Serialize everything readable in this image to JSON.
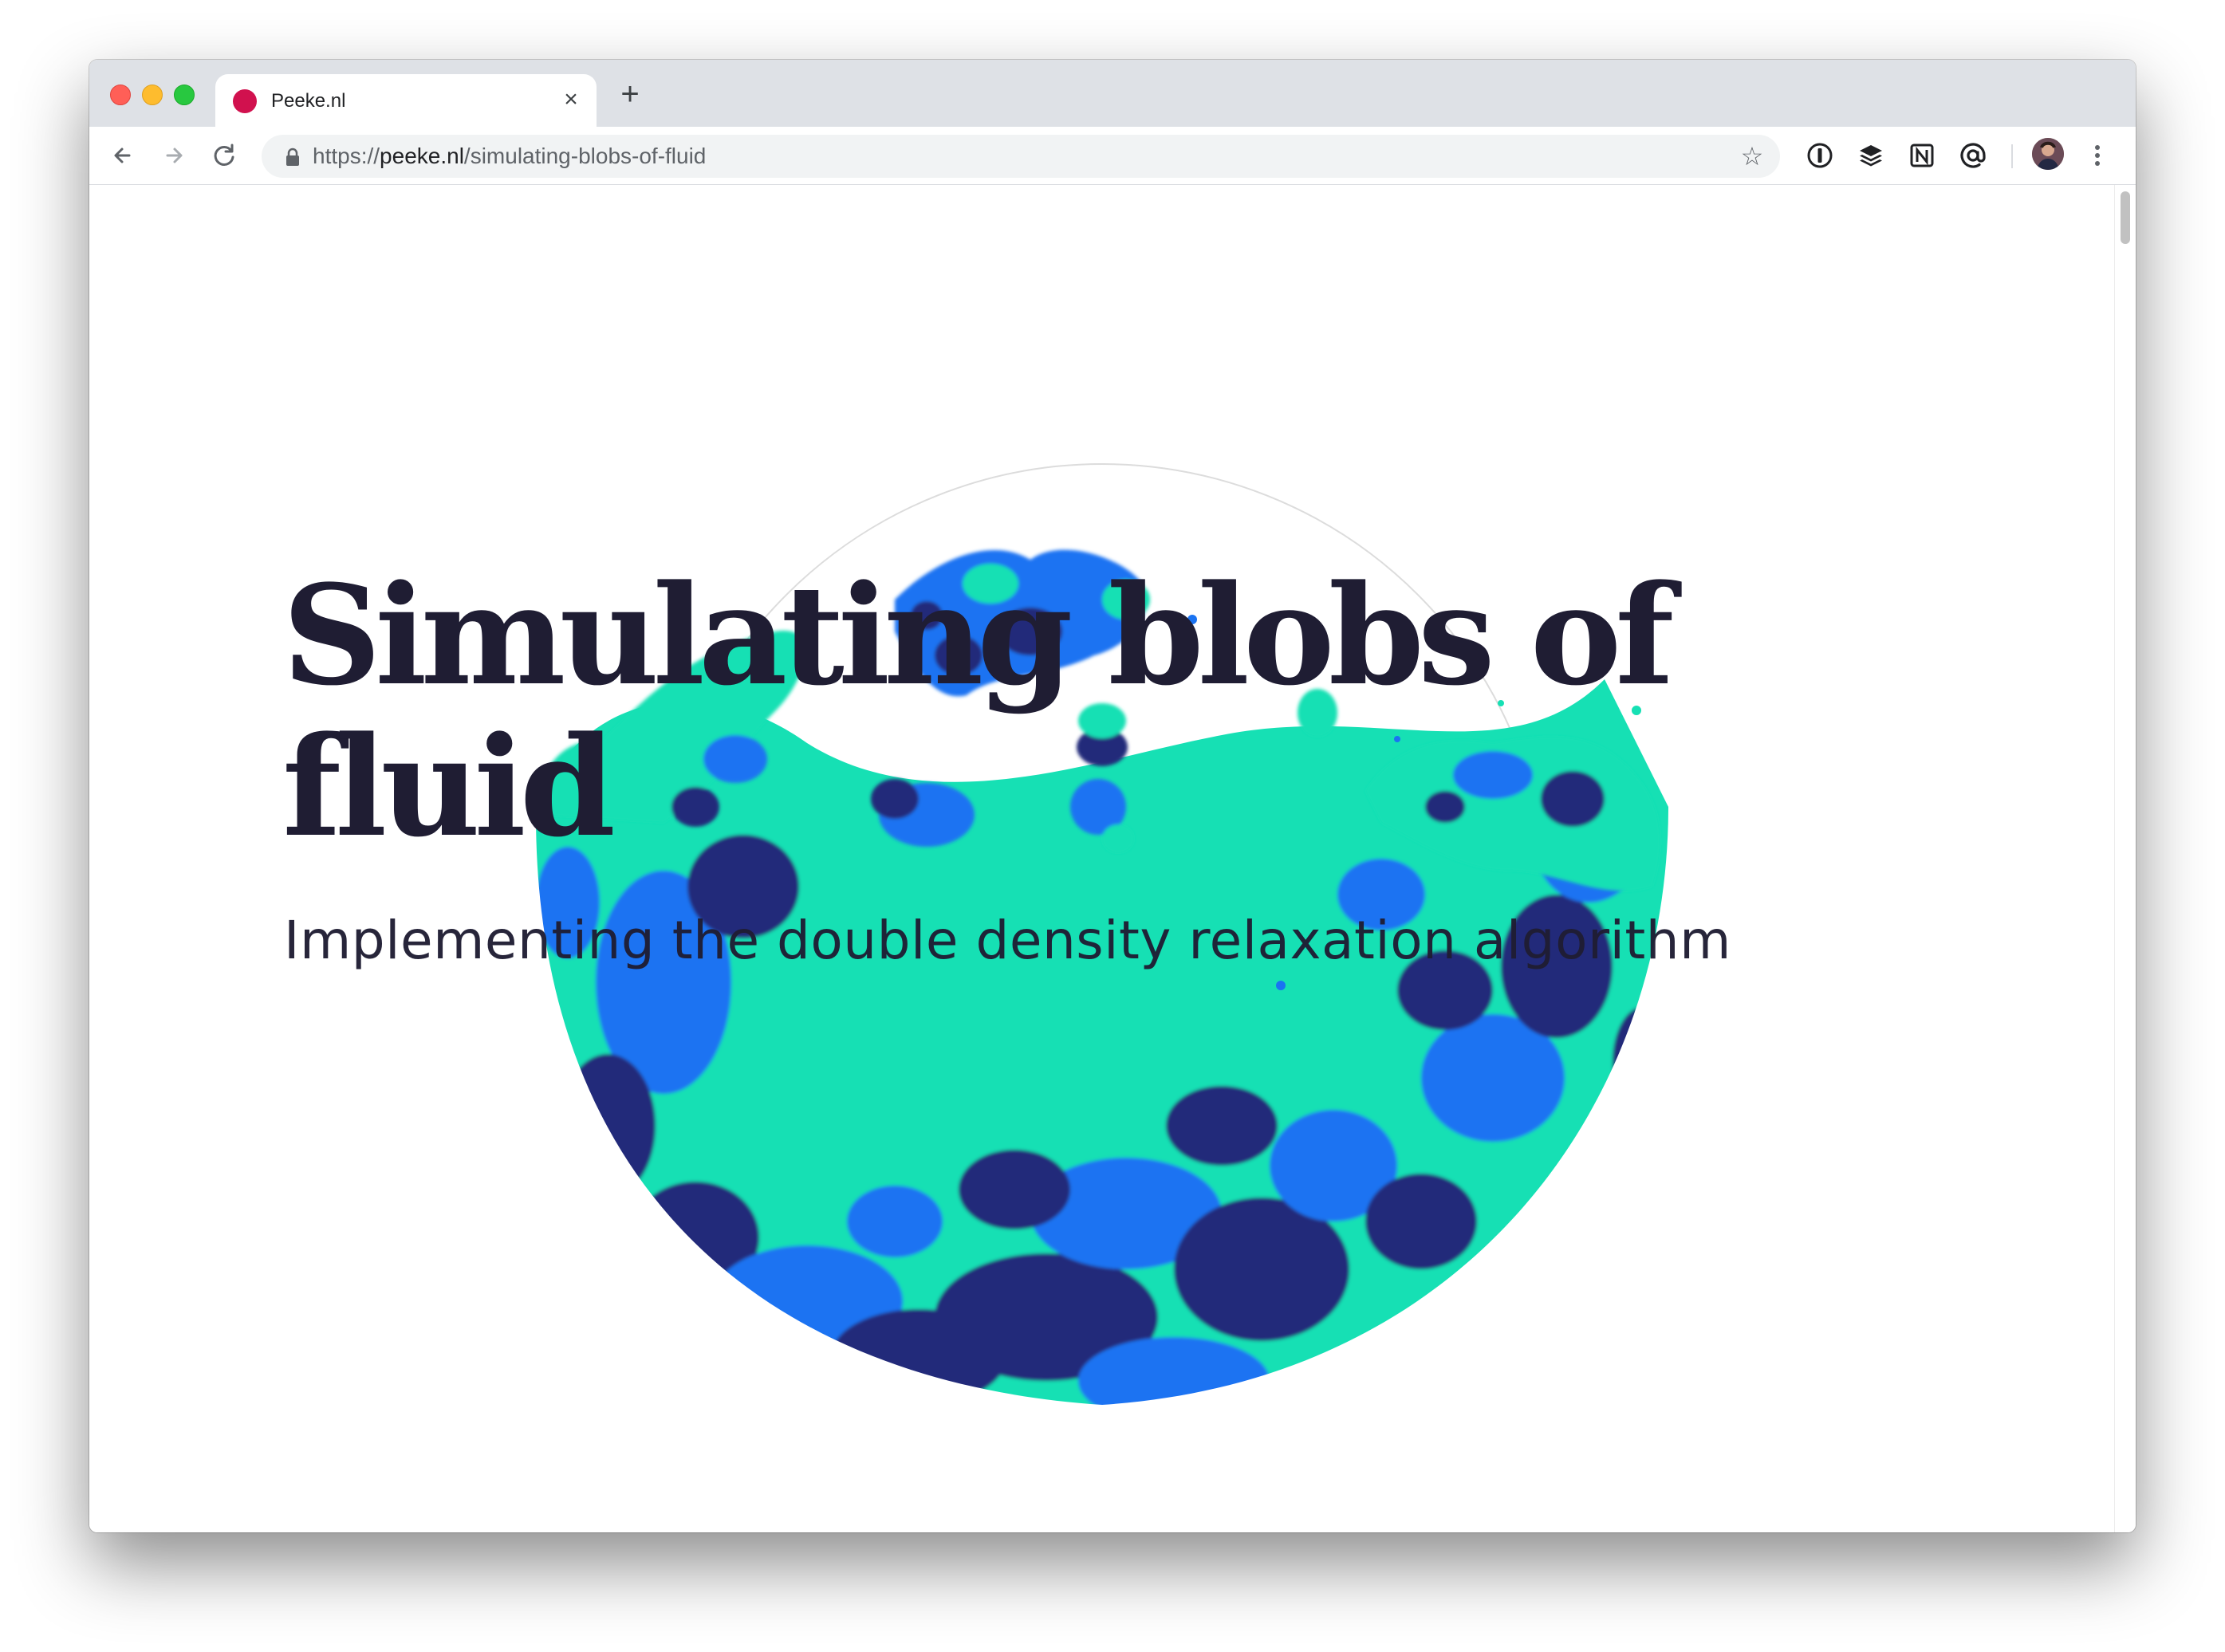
{
  "browser": {
    "tab": {
      "title": "Peeke.nl",
      "favicon_color": "#d1114e",
      "close_icon": "close-icon"
    },
    "new_tab_icon": "plus-icon",
    "url": {
      "scheme": "https://",
      "host": "peeke.nl",
      "path": "/simulating-blobs-of-fluid"
    },
    "extensions": [
      "1password-icon",
      "buffer-icon",
      "notion-icon",
      "at-sign-icon"
    ]
  },
  "page": {
    "title": "Simulating blobs of fluid",
    "subtitle": "Implementing the double density relaxation algorithm"
  },
  "colors": {
    "text": "#1f1d33",
    "fluid_teal": "#16e0b4",
    "fluid_blue": "#1a73f2",
    "fluid_navy": "#24297a",
    "circle_outline": "#dcdcdc"
  }
}
